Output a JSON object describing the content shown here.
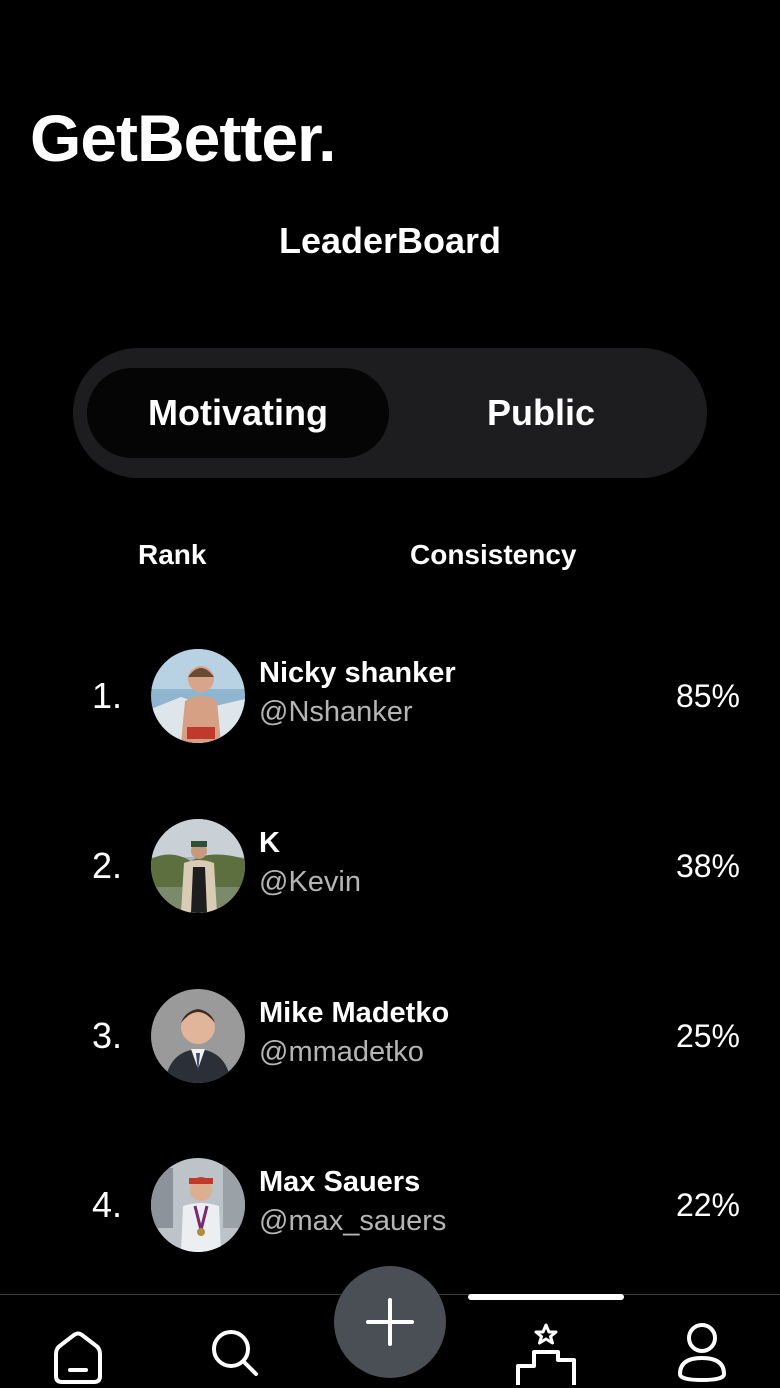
{
  "app": {
    "brand": "GetBetter."
  },
  "screen": {
    "title": "LeaderBoard"
  },
  "segments": [
    {
      "label": "Motivating",
      "selected": true
    },
    {
      "label": "Public",
      "selected": false
    }
  ],
  "columns": {
    "rank": "Rank",
    "consistency": "Consistency"
  },
  "leaderboard": [
    {
      "rank": "1.",
      "name": "Nicky shanker",
      "handle": "@Nshanker",
      "consistency": "85%"
    },
    {
      "rank": "2.",
      "name": "K",
      "handle": "@Kevin",
      "consistency": "38%"
    },
    {
      "rank": "3.",
      "name": "Mike Madetko",
      "handle": "@mmadetko",
      "consistency": "25%"
    },
    {
      "rank": "4.",
      "name": "Max Sauers",
      "handle": "@max_sauers",
      "consistency": "22%"
    }
  ],
  "tabbar": {
    "items": [
      {
        "icon": "home-icon",
        "active": false
      },
      {
        "icon": "search-icon",
        "active": false
      },
      {
        "icon": "plus-icon",
        "active": false
      },
      {
        "icon": "leaderboard-icon",
        "active": true
      },
      {
        "icon": "profile-icon",
        "active": false
      }
    ]
  },
  "colors": {
    "background": "#000000",
    "segment_track": "#1d1d1f",
    "segment_active": "#050505",
    "fab": "#4a4e55",
    "handle_text": "#b5b5b5"
  }
}
